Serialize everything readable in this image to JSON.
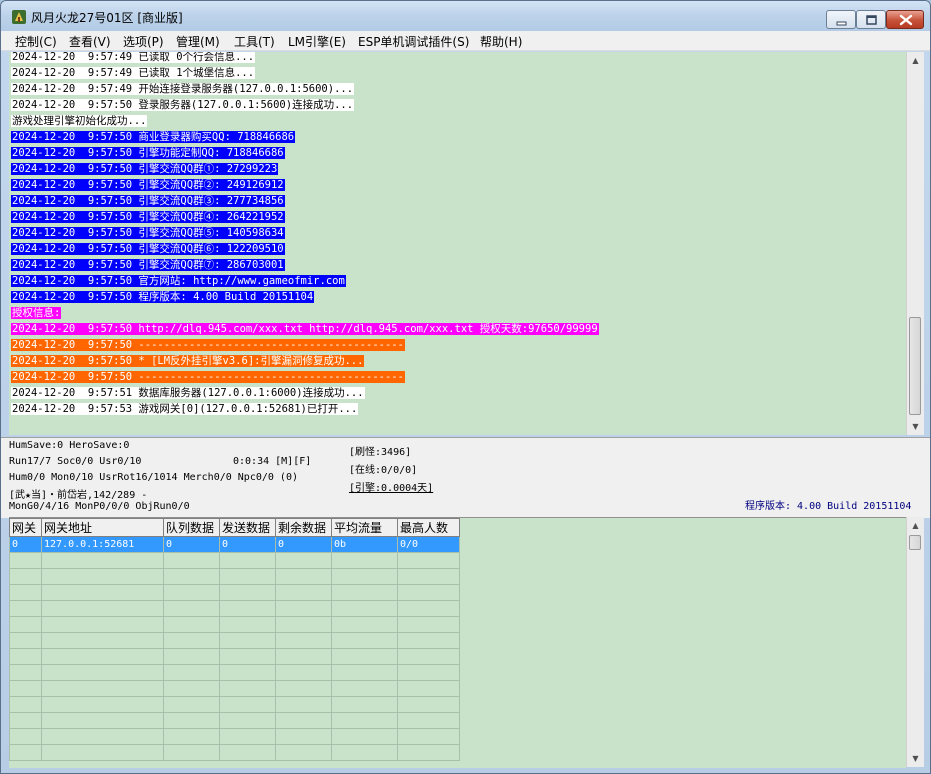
{
  "window": {
    "title": "风月火龙27号01区 [商业版]"
  },
  "menu": [
    "控制(C)",
    "查看(V)",
    "选项(P)",
    "管理(M)",
    "工具(T)",
    "LM引擎(E)",
    "ESP单机调试插件(S)",
    "帮助(H)"
  ],
  "log": [
    {
      "text": "2024-12-20  9:57:49 已读取 0个行会信息...",
      "style": "white"
    },
    {
      "text": "2024-12-20  9:57:49 已读取 1个城堡信息...",
      "style": "white"
    },
    {
      "text": "2024-12-20  9:57:49 开始连接登录服务器(127.0.0.1:5600)...",
      "style": "white"
    },
    {
      "text": "2024-12-20  9:57:50 登录服务器(127.0.0.1:5600)连接成功...",
      "style": "white"
    },
    {
      "text": "游戏处理引擎初始化成功...",
      "style": "white"
    },
    {
      "text": "2024-12-20  9:57:50 商业登录器购买QQ: 718846686",
      "style": "blue"
    },
    {
      "text": "2024-12-20  9:57:50 引擎功能定制QQ: 718846686",
      "style": "blue"
    },
    {
      "text": "2024-12-20  9:57:50 引擎交流QQ群①: 27299223",
      "style": "blue"
    },
    {
      "text": "2024-12-20  9:57:50 引擎交流QQ群②: 249126912",
      "style": "blue"
    },
    {
      "text": "2024-12-20  9:57:50 引擎交流QQ群③: 277734856",
      "style": "blue"
    },
    {
      "text": "2024-12-20  9:57:50 引擎交流QQ群④: 264221952",
      "style": "blue"
    },
    {
      "text": "2024-12-20  9:57:50 引擎交流QQ群⑤: 140598634",
      "style": "blue"
    },
    {
      "text": "2024-12-20  9:57:50 引擎交流QQ群⑥: 122209510",
      "style": "blue"
    },
    {
      "text": "2024-12-20  9:57:50 引擎交流QQ群⑦: 286703001",
      "style": "blue"
    },
    {
      "text": "2024-12-20  9:57:50 官方网站: http://www.gameofmir.com",
      "style": "blue"
    },
    {
      "text": "2024-12-20  9:57:50 程序版本: 4.00 Build 20151104",
      "style": "blue"
    },
    {
      "text": "授权信息:",
      "style": "magenta"
    },
    {
      "text": "2024-12-20  9:57:50 http://dlq.945.com/xxx.txt http://dlq.945.com/xxx.txt 授权天数:97650/99999",
      "style": "magenta"
    },
    {
      "text": "2024-12-20  9:57:50 ------------------------------------------",
      "style": "orange"
    },
    {
      "text": "2024-12-20  9:57:50 * [LM反外挂引擎v3.6]:引擎漏洞修复成功...",
      "style": "orange"
    },
    {
      "text": "2024-12-20  9:57:50 ------------------------------------------",
      "style": "orange"
    },
    {
      "text": "2024-12-20  9:57:51 数据库服务器(127.0.0.1:6000)连接成功...",
      "style": "white"
    },
    {
      "text": "2024-12-20  9:57:53 游戏网关[0](127.0.0.1:52681)已打开...",
      "style": "white"
    }
  ],
  "status": {
    "save": "HumSave:0 HeroSave:0",
    "run": "Run17/7 Soc0/0 Usr0/10",
    "time": "0:0:34 [M][F]",
    "hum": "Hum0/0 Mon0/10 UsrRot16/1014 Merch0/0 Npc0/0 (0)",
    "map": "[武★当]・前岱岩,142/289 -",
    "mon": "MonG0/4/16 MonP0/0/0 ObjRun0/0",
    "refresh": "[刷怪:3496]",
    "online": "[在线:0/0/0]",
    "engine": "[引擎:0.0004天]",
    "version": "程序版本: 4.00 Build 20151104"
  },
  "grid": {
    "headers": [
      "网关",
      "网关地址",
      "队列数据",
      "发送数据",
      "剩余数据",
      "平均流量",
      "最高人数"
    ],
    "rows": [
      [
        "0",
        "127.0.0.1:52681",
        "0",
        "0",
        "0",
        "0b",
        "0/0"
      ]
    ],
    "empty_rows": 13
  },
  "colors": {
    "log_bg": "#c9e3cb",
    "blue": "#0000ff",
    "magenta": "#ff00ff",
    "orange": "#ff6600",
    "selection": "#3399ff"
  }
}
